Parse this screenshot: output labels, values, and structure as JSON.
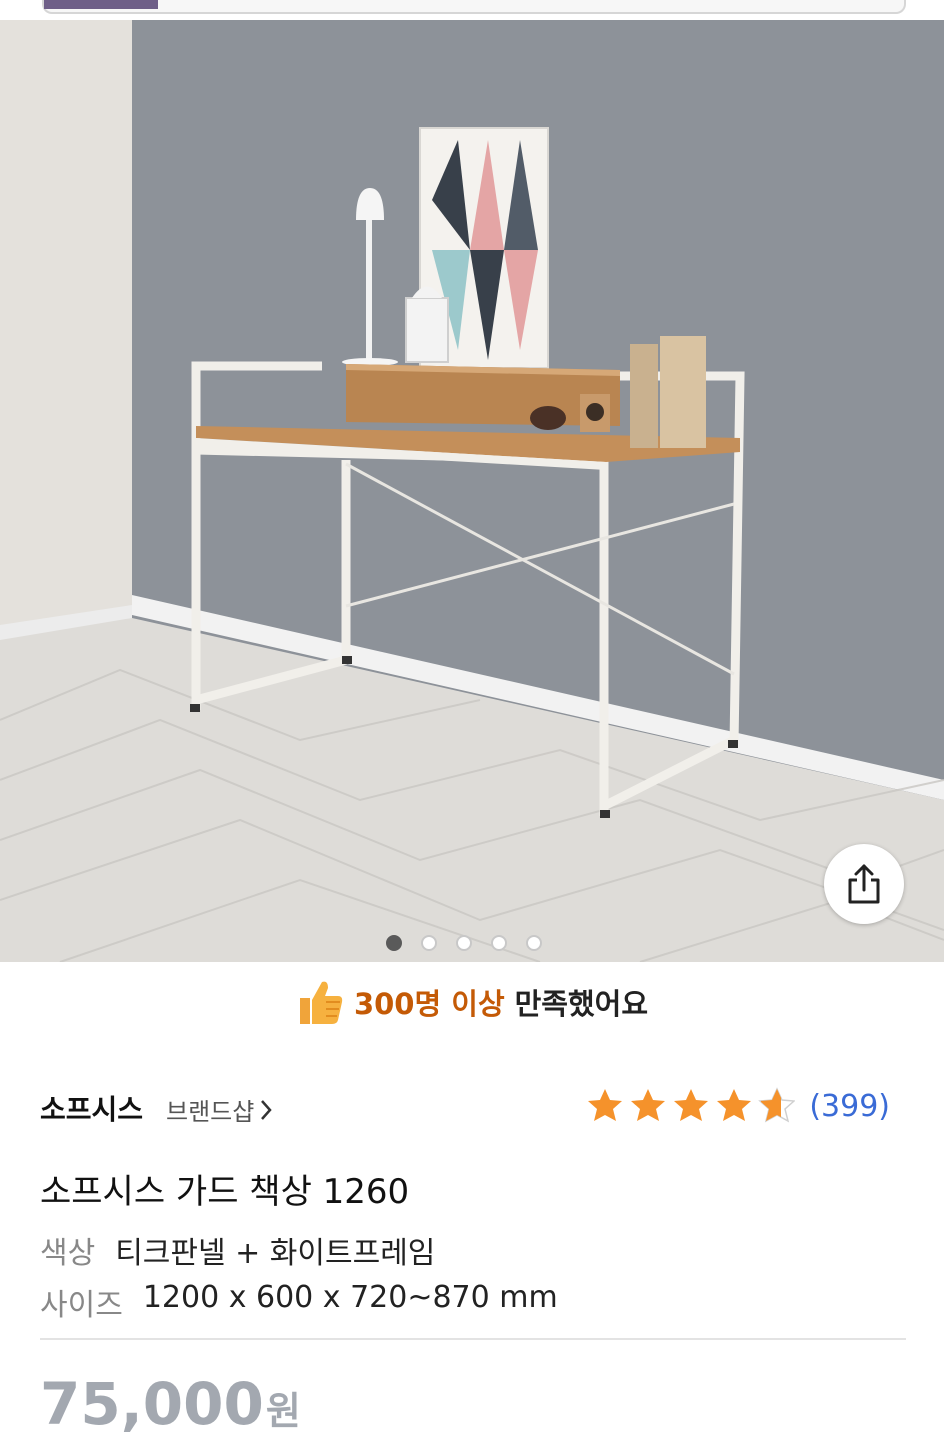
{
  "satisfaction": {
    "highlight": "300명 이상",
    "rest": "만족했어요"
  },
  "product": {
    "brand": "소프시스",
    "brand_shop": "브랜드샵",
    "rating": 4.5,
    "review_count": "(399)",
    "title": "소프시스 가드 책상 1260",
    "color_label": "색상",
    "color_value": "티크판넬 + 화이트프레임",
    "size_label": "사이즈",
    "size_value": "1200 x 600 x 720~870 mm",
    "price": "75,000",
    "currency": "원"
  },
  "carousel": {
    "total": 5,
    "active_index": 0
  },
  "icons": {
    "share": "share-icon",
    "thumbs_up": "thumbs-up-icon",
    "chevron": "chevron-right-icon",
    "star": "star-icon"
  },
  "colors": {
    "highlight": "#c45a06",
    "link": "#3a6bd6",
    "star": "#f5922b",
    "price": "#a3a8b0"
  }
}
